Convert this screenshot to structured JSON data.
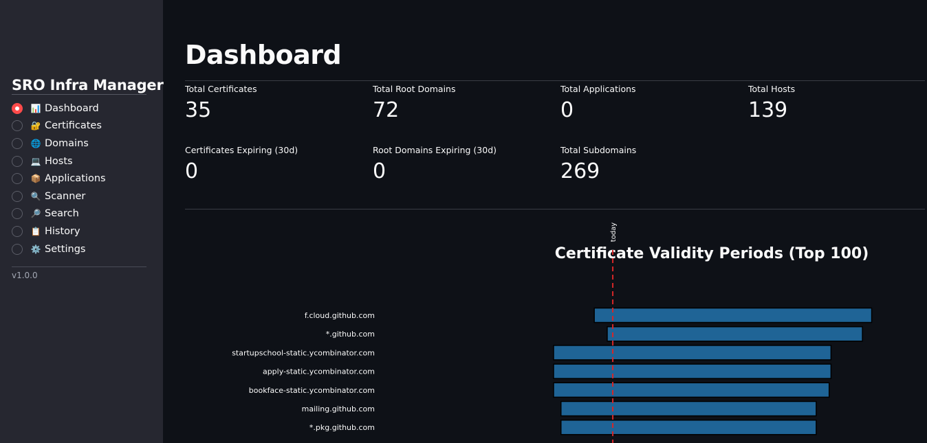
{
  "sidebar": {
    "title": "SRO Infra Manager",
    "version": "v1.0.0",
    "items": [
      {
        "label": "Dashboard",
        "icon": "📊",
        "icon_name": "bar-chart-icon",
        "selected": true
      },
      {
        "label": "Certificates",
        "icon": "🔐",
        "icon_name": "lock-key-icon",
        "selected": false
      },
      {
        "label": "Domains",
        "icon": "🌐",
        "icon_name": "globe-icon",
        "selected": false
      },
      {
        "label": "Hosts",
        "icon": "💻",
        "icon_name": "laptop-icon",
        "selected": false
      },
      {
        "label": "Applications",
        "icon": "📦",
        "icon_name": "package-icon",
        "selected": false
      },
      {
        "label": "Scanner",
        "icon": "🔍",
        "icon_name": "magnifier-icon",
        "selected": false
      },
      {
        "label": "Search",
        "icon": "🔎",
        "icon_name": "search-icon",
        "selected": false
      },
      {
        "label": "History",
        "icon": "📋",
        "icon_name": "clipboard-icon",
        "selected": false
      },
      {
        "label": "Settings",
        "icon": "⚙️",
        "icon_name": "gear-icon",
        "selected": false
      }
    ]
  },
  "main": {
    "title": "Dashboard",
    "metrics": [
      {
        "label": "Total Certificates",
        "value": "35"
      },
      {
        "label": "Total Root Domains",
        "value": "72"
      },
      {
        "label": "Total Applications",
        "value": "0"
      },
      {
        "label": "Total Hosts",
        "value": "139"
      },
      {
        "label": "Certificates Expiring (30d)",
        "value": "0"
      },
      {
        "label": "Root Domains Expiring (30d)",
        "value": "0"
      },
      {
        "label": "Total Subdomains",
        "value": "269"
      }
    ]
  },
  "colors": {
    "accent": "#ff4b4b",
    "bar": "#1f6496",
    "bar_edge": "#000000",
    "today_line": "#d62728",
    "background": "#0e1117",
    "sidebar": "#262730"
  },
  "chart_data": {
    "type": "bar",
    "orientation": "horizontal",
    "title": "Certificate Validity Periods (Top 100)",
    "reference_line_label": "today",
    "categories": [
      "f.cloud.github.com",
      "*.github.com",
      "startupschool-static.ycombinator.com",
      "apply-static.ycombinator.com",
      "bookface-static.ycombinator.com",
      "mailing.github.com",
      "*.pkg.github.com"
    ],
    "series": [
      {
        "values": [
          {
            "start": -10,
            "end": 140
          },
          {
            "start": -3,
            "end": 135
          },
          {
            "start": -32,
            "end": 118
          },
          {
            "start": -32,
            "end": 118
          },
          {
            "start": -32,
            "end": 117
          },
          {
            "start": -28,
            "end": 110
          },
          {
            "start": -28,
            "end": 110
          }
        ]
      }
    ],
    "xlim": [
      -32,
      145
    ],
    "grid": false
  }
}
